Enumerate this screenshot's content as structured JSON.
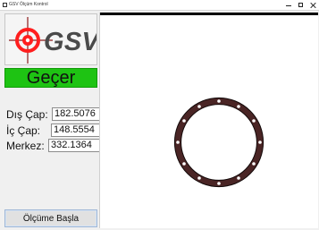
{
  "window": {
    "title": "GSV Ölçüm Kontrol"
  },
  "logo": {
    "text": "GSV"
  },
  "status": {
    "text": "Geçer",
    "color": "#1ec313"
  },
  "measurements": {
    "dis_cap": {
      "label": "Dış Çap:",
      "value": "182.5076"
    },
    "ic_cap": {
      "label": "İç Çap:",
      "value": "148.5554"
    },
    "merkez": {
      "label": "Merkez:",
      "value": "332.1364"
    }
  },
  "actions": {
    "start_measurement": "Ölçüme Başla"
  },
  "colors": {
    "window_bg": "#f0f0f0",
    "status_bg": "#1ec313",
    "viewer_bg": "#ffffff",
    "ring_fill": "#4a2525",
    "ring_outline": "#120909",
    "logo_red": "#ff1e1e"
  },
  "icons": {
    "app": "app-icon",
    "minimize": "minimize-icon",
    "maximize": "maximize-icon",
    "close": "close-icon",
    "logo_mark": "target-icon"
  }
}
